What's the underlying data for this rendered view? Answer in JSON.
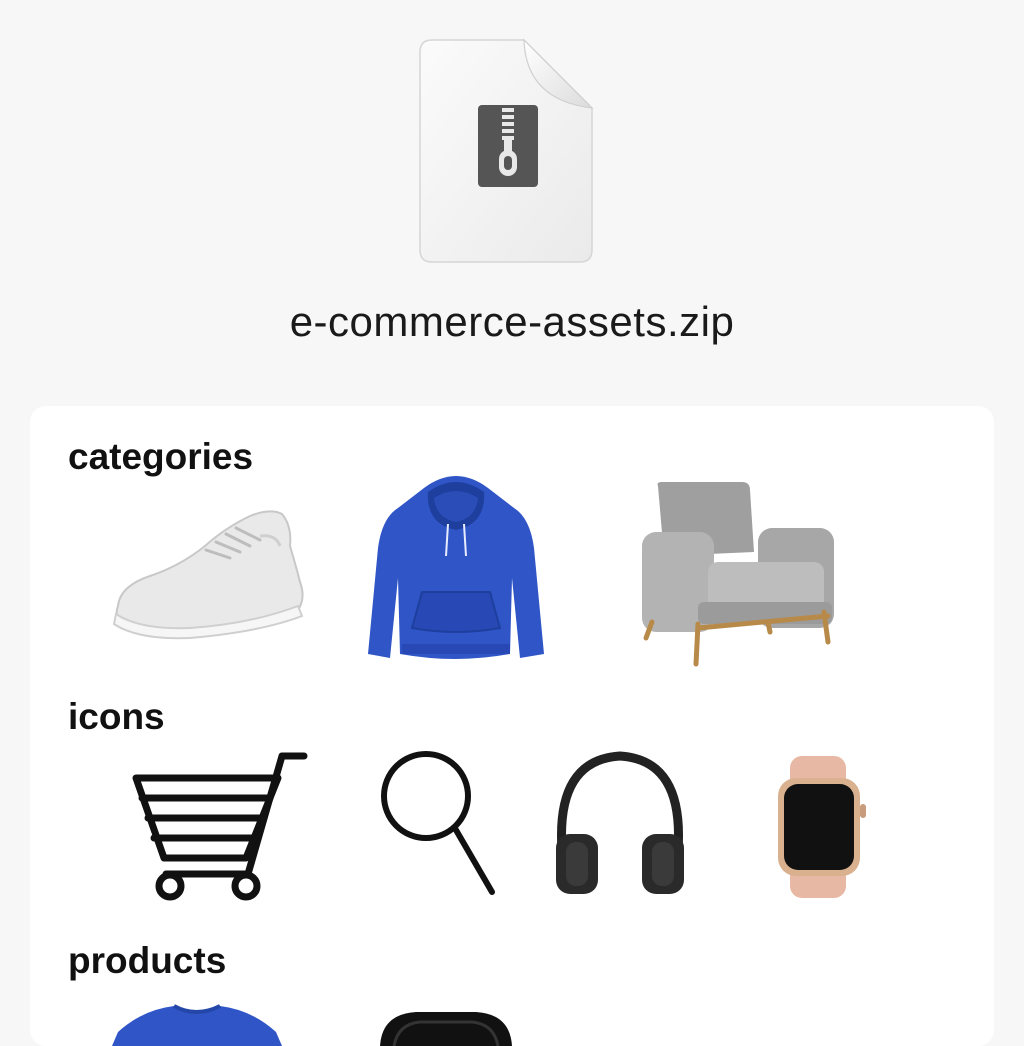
{
  "archive": {
    "file_name": "e-commerce-assets.zip",
    "icon": "zip-archive-icon"
  },
  "sections": [
    {
      "title": "categories",
      "items": [
        {
          "icon": "sneaker-icon",
          "color": "#e6e6e6"
        },
        {
          "icon": "hoodie-icon",
          "color": "#2f55c7"
        },
        {
          "icon": "armchair-icon",
          "color": "#a9a9a9"
        }
      ]
    },
    {
      "title": "icons",
      "items": [
        {
          "icon": "shopping-cart-icon",
          "color": "#111111"
        },
        {
          "icon": "search-icon",
          "color": "#111111"
        },
        {
          "icon": "headphones-icon",
          "color": "#222222"
        },
        {
          "icon": "smartwatch-icon",
          "color": "#e7b8a4"
        }
      ]
    },
    {
      "title": "products",
      "items": [
        {
          "icon": "tshirt-icon",
          "color": "#2f55c7"
        },
        {
          "icon": "earbuds-case-icon",
          "color": "#111111"
        }
      ]
    }
  ]
}
